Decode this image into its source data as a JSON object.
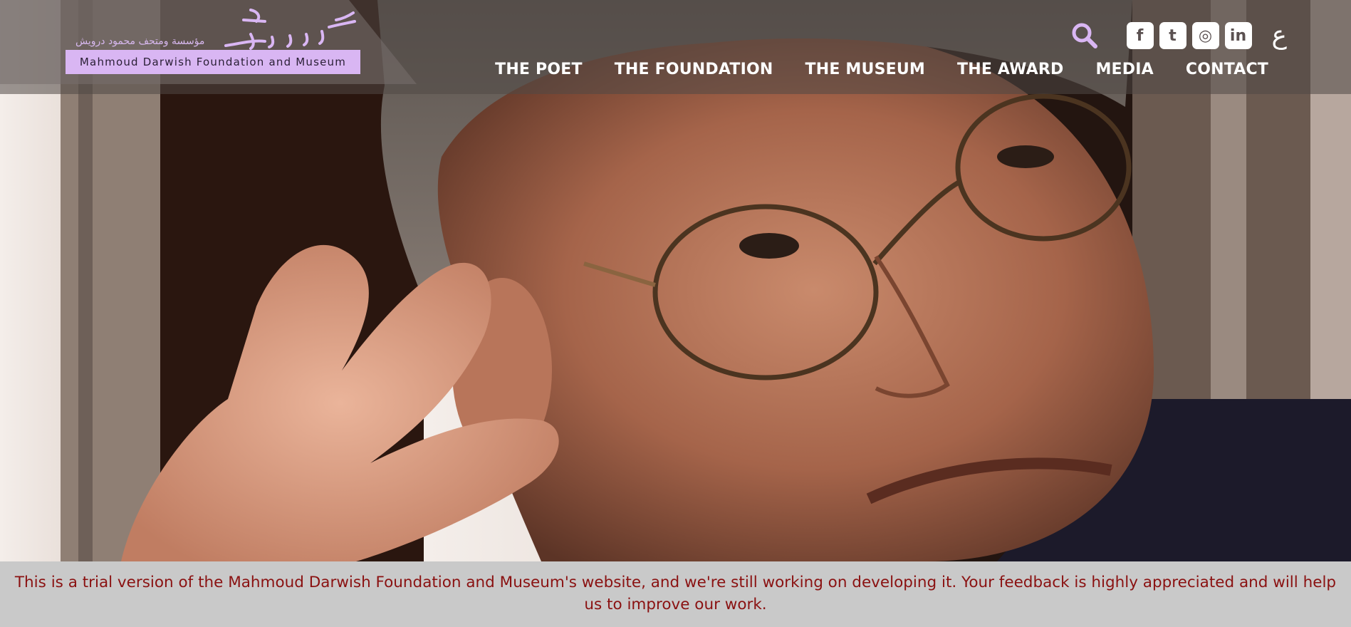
{
  "logo": {
    "arabic_text": "مؤسسة ومتحف محمود درويش",
    "english_text": "Mahmoud Darwish Foundation and Museum",
    "accent_color": "#d9b6f3"
  },
  "header": {
    "search_icon": "search-icon",
    "social": [
      {
        "name": "facebook-icon",
        "glyph": "f"
      },
      {
        "name": "twitter-icon",
        "glyph": "t"
      },
      {
        "name": "instagram-icon",
        "glyph": "◎"
      },
      {
        "name": "linkedin-icon",
        "glyph": "in"
      }
    ],
    "language_toggle": "ع"
  },
  "nav": {
    "items": [
      {
        "label": "THE POET"
      },
      {
        "label": "THE FOUNDATION"
      },
      {
        "label": "THE MUSEUM"
      },
      {
        "label": "THE AWARD"
      },
      {
        "label": "MEDIA"
      },
      {
        "label": "CONTACT"
      }
    ]
  },
  "notice": {
    "text": "This is a trial version of the Mahmoud Darwish Foundation and Museum's website, and we're still working on developing it. Your feedback is highly appreciated and will help us to improve our work."
  },
  "colors": {
    "notice_text": "#8a1111",
    "notice_bg": "#c9c9c9",
    "nav_text": "#ffffff",
    "search_icon": "#d9b6f3"
  }
}
